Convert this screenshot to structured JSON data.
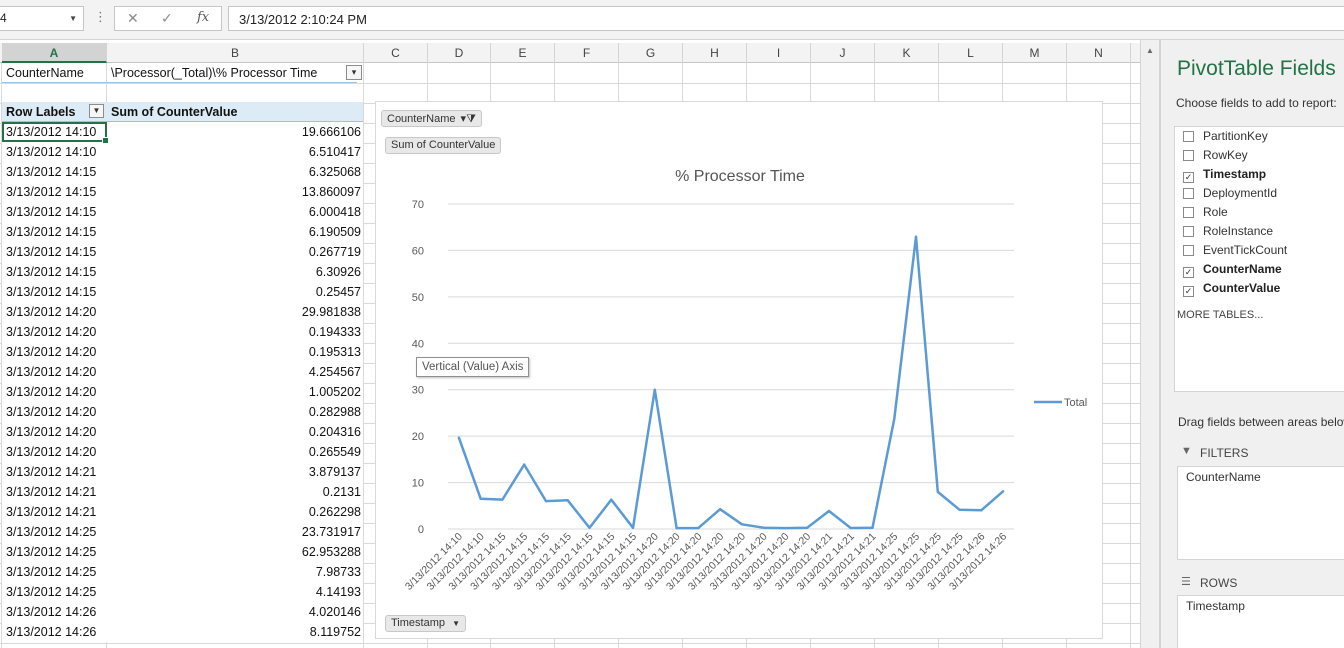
{
  "formula_bar": {
    "name_box": "4",
    "cancel_glyph": "✕",
    "enter_glyph": "✓",
    "fx_glyph": "fx",
    "value": "3/13/2012  2:10:24 PM"
  },
  "columns": [
    "A",
    "B",
    "C",
    "D",
    "E",
    "F",
    "G",
    "H",
    "I",
    "J",
    "K",
    "L",
    "M",
    "N"
  ],
  "filter_row": {
    "label": "CounterName",
    "value": "\\Processor(_Total)\\% Processor Time"
  },
  "pivot_header": {
    "row_labels": "Row Labels",
    "sum_label": "Sum of CounterValue"
  },
  "rows": [
    {
      "label": "3/13/2012 14:10",
      "value": "19.666106"
    },
    {
      "label": "3/13/2012 14:10",
      "value": "6.510417"
    },
    {
      "label": "3/13/2012 14:15",
      "value": "6.325068"
    },
    {
      "label": "3/13/2012 14:15",
      "value": "13.860097"
    },
    {
      "label": "3/13/2012 14:15",
      "value": "6.000418"
    },
    {
      "label": "3/13/2012 14:15",
      "value": "6.190509"
    },
    {
      "label": "3/13/2012 14:15",
      "value": "0.267719"
    },
    {
      "label": "3/13/2012 14:15",
      "value": "6.30926"
    },
    {
      "label": "3/13/2012 14:15",
      "value": "0.25457"
    },
    {
      "label": "3/13/2012 14:20",
      "value": "29.981838"
    },
    {
      "label": "3/13/2012 14:20",
      "value": "0.194333"
    },
    {
      "label": "3/13/2012 14:20",
      "value": "0.195313"
    },
    {
      "label": "3/13/2012 14:20",
      "value": "4.254567"
    },
    {
      "label": "3/13/2012 14:20",
      "value": "1.005202"
    },
    {
      "label": "3/13/2012 14:20",
      "value": "0.282988"
    },
    {
      "label": "3/13/2012 14:20",
      "value": "0.204316"
    },
    {
      "label": "3/13/2012 14:20",
      "value": "0.265549"
    },
    {
      "label": "3/13/2012 14:21",
      "value": "3.879137"
    },
    {
      "label": "3/13/2012 14:21",
      "value": "0.2131"
    },
    {
      "label": "3/13/2012 14:21",
      "value": "0.262298"
    },
    {
      "label": "3/13/2012 14:25",
      "value": "23.731917"
    },
    {
      "label": "3/13/2012 14:25",
      "value": "62.953288"
    },
    {
      "label": "3/13/2012 14:25",
      "value": "7.98733"
    },
    {
      "label": "3/13/2012 14:25",
      "value": "4.14193"
    },
    {
      "label": "3/13/2012 14:26",
      "value": "4.020146"
    },
    {
      "label": "3/13/2012 14:26",
      "value": "8.119752"
    }
  ],
  "chart": {
    "counter_name_button": "CounterName",
    "sum_button": "Sum of CounterValue",
    "timestamp_button": "Timestamp",
    "tooltip": "Vertical (Value) Axis"
  },
  "chart_data": {
    "type": "line",
    "title": "% Processor Time",
    "xlabel": "",
    "ylabel": "",
    "ylim": [
      0,
      70
    ],
    "yticks": [
      0,
      10,
      20,
      30,
      40,
      50,
      60,
      70
    ],
    "grid": true,
    "legend": "right",
    "categories": [
      "3/13/2012 14:10",
      "3/13/2012 14:10",
      "3/13/2012 14:15",
      "3/13/2012 14:15",
      "3/13/2012 14:15",
      "3/13/2012 14:15",
      "3/13/2012 14:15",
      "3/13/2012 14:15",
      "3/13/2012 14:15",
      "3/13/2012 14:20",
      "3/13/2012 14:20",
      "3/13/2012 14:20",
      "3/13/2012 14:20",
      "3/13/2012 14:20",
      "3/13/2012 14:20",
      "3/13/2012 14:20",
      "3/13/2012 14:20",
      "3/13/2012 14:21",
      "3/13/2012 14:21",
      "3/13/2012 14:21",
      "3/13/2012 14:25",
      "3/13/2012 14:25",
      "3/13/2012 14:25",
      "3/13/2012 14:25",
      "3/13/2012 14:26",
      "3/13/2012 14:26"
    ],
    "series": [
      {
        "name": "Total",
        "color": "#5b9bd5",
        "values": [
          19.666106,
          6.510417,
          6.325068,
          13.860097,
          6.000418,
          6.190509,
          0.267719,
          6.30926,
          0.25457,
          29.981838,
          0.194333,
          0.195313,
          4.254567,
          1.005202,
          0.282988,
          0.204316,
          0.265549,
          3.879137,
          0.2131,
          0.262298,
          23.731917,
          62.953288,
          7.98733,
          4.14193,
          4.020146,
          8.119752
        ]
      }
    ]
  },
  "pane": {
    "title": "PivotTable Fields",
    "subtitle": "Choose fields to add to report:",
    "fields": [
      {
        "label": "PartitionKey",
        "checked": false
      },
      {
        "label": "RowKey",
        "checked": false
      },
      {
        "label": "Timestamp",
        "checked": true
      },
      {
        "label": "DeploymentId",
        "checked": false
      },
      {
        "label": "Role",
        "checked": false
      },
      {
        "label": "RoleInstance",
        "checked": false
      },
      {
        "label": "EventTickCount",
        "checked": false
      },
      {
        "label": "CounterName",
        "checked": true
      },
      {
        "label": "CounterValue",
        "checked": true
      }
    ],
    "more_tables": "MORE TABLES...",
    "drag_label": "Drag fields between areas below:",
    "filters_label": "FILTERS",
    "filters_item": "CounterName",
    "rows_label": "ROWS",
    "rows_item": "Timestamp"
  }
}
